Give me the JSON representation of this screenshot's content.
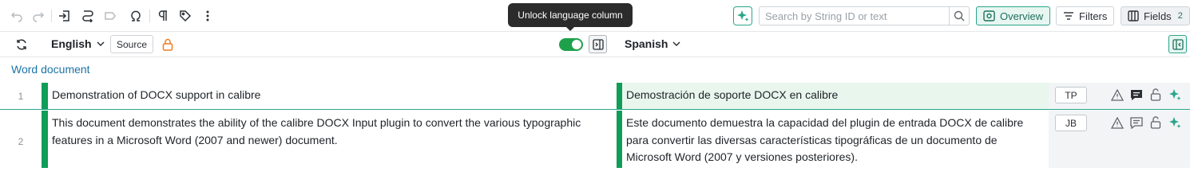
{
  "toolbar": {
    "icons": [
      "undo-icon",
      "redo-icon",
      "import-icon",
      "merge-icon",
      "label-icon",
      "special-chars-icon",
      "pilcrow-icon",
      "tag-icon",
      "more-vertical-icon"
    ],
    "search_placeholder": "Search by String ID or text",
    "overview_label": "Overview",
    "filters_label": "Filters",
    "fields_label": "Fields",
    "fields_count": "2"
  },
  "tooltip": {
    "text": "Unlock language column"
  },
  "languages": {
    "source": {
      "name": "English",
      "badge": "Source",
      "locked": true
    },
    "target": {
      "name": "Spanish",
      "unlock_toggle_on": true
    }
  },
  "section_title": "Word document",
  "rows": [
    {
      "number": "1",
      "source": "Demonstration of DOCX support in calibre",
      "target": "Demostración de soporte DOCX en calibre",
      "initials": "TP",
      "comment_active": true,
      "selected": true
    },
    {
      "number": "2",
      "source": "This document demonstrates the ability of the calibre DOCX Input plugin to convert the various typographic features in a Microsoft Word (2007 and newer) document.",
      "target": "Este documento demuestra la capacidad del plugin de entrada DOCX de calibre para convertir las diversas características tipográficas de un documento de Microsoft Word (2007 y versiones posteriores).",
      "initials": "JB",
      "comment_active": false,
      "selected": false
    }
  ],
  "colors": {
    "accent": "#2aa58a",
    "status_green": "#0f9d58",
    "lock_orange": "#f07d22",
    "link_blue": "#1a73a8"
  }
}
